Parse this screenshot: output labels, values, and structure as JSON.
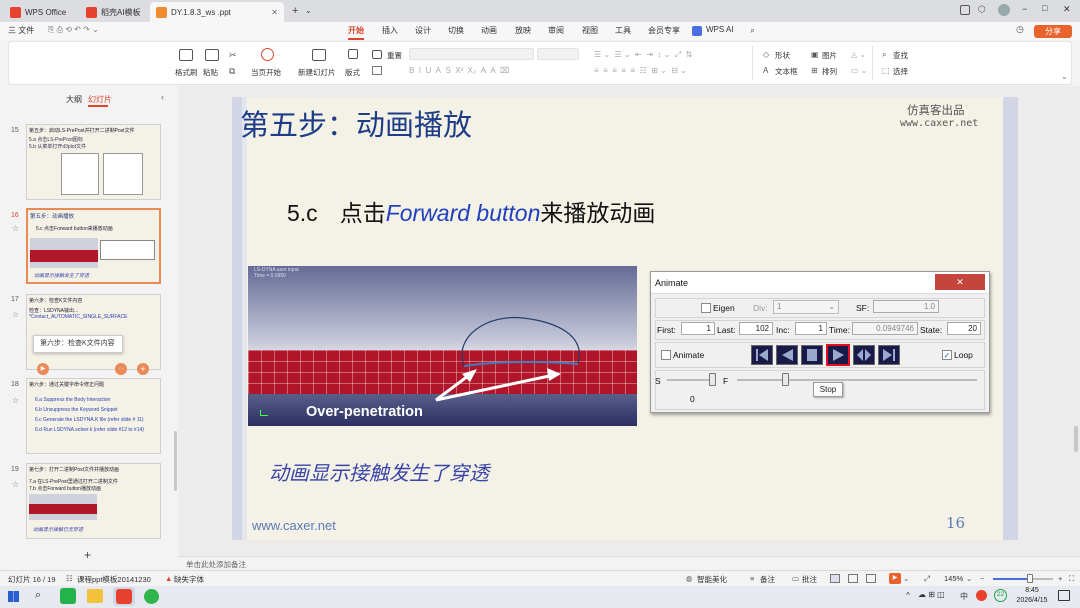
{
  "titlebar": {
    "tabs": [
      {
        "label": "WPS Office"
      },
      {
        "label": "稻壳AI模板"
      },
      {
        "label": "DY.1.8.3_ws .ppt"
      }
    ],
    "add_tab": "+",
    "window_controls": {
      "minimize": "−",
      "maximize": "□",
      "close": "✕"
    }
  },
  "menubar": {
    "file": "三 文件",
    "items": [
      "开始",
      "插入",
      "设计",
      "切换",
      "动画",
      "放映",
      "审阅",
      "视图",
      "工具",
      "会员专享"
    ],
    "active": "开始",
    "wps_ai": "WPS AI",
    "share": "分享"
  },
  "ribbon": {
    "format_painter": "格式刷",
    "paste": "粘贴",
    "from_current": "当页开始",
    "new_slide": "新建幻灯片",
    "layout": "版式",
    "reset": "重置",
    "shape": "形状",
    "textbox": "文本框",
    "picture": "图片",
    "arrange": "排列",
    "find": "查找",
    "select": "选择"
  },
  "panel": {
    "tab_outline": "大纲",
    "tab_slides": "幻灯片",
    "thumbs": [
      {
        "num": "15",
        "title": "第五步：启动LS-PrePost并打开二进制Post文件",
        "sub": "5.a 点击LS-PrePost图标",
        "sub2": "5.b 从菜单打开d3plot文件"
      },
      {
        "num": "16",
        "title": "第五步：动画播放",
        "sub": "5.c 点击Forward button来播放动画",
        "caption": "动画显示接触发生了穿透"
      },
      {
        "num": "17",
        "title": "第六步：检查K文件内容",
        "sub": "检查：LSDYNA输出...",
        "sub2": "*Contact_AUTOMATIC_SINGLE_SURFACE",
        "tooltip": "第六步：检查K文件内容"
      },
      {
        "num": "18",
        "title": "第六步：通过关键字命令修正问题",
        "l1": "6.a Suppress the Body Interaction",
        "l2": "6.b Unsuppress the Keyword Snippet",
        "l3": "6.c Generate the LSDYNA.K file (refer slide # 11)",
        "l4": "6.d Run LSDYNA.solver.k (refer slide #12 to #14)"
      },
      {
        "num": "19",
        "title": "第七步：打开二进制Post文件并播放动画",
        "sub": "7.a 在LS-PrePost里通过打开二进制文件",
        "sub2": "7.b 点击Forward button播放动画",
        "caption": "动画显示接触已无穿透"
      }
    ],
    "add_slide": "+"
  },
  "slide": {
    "title": "第五步：动画播放",
    "brand_cn": "仿真客出品",
    "brand_url": "www.caxer.net",
    "step_num": "5.c",
    "step_pre": "点击",
    "step_btn": "Forward button",
    "step_post": "来播放动画",
    "sim_header": "LS-DYNA user input",
    "sim_time": "Time =   0.0950",
    "sim_label": "Over-penetration",
    "caption": "动画显示接触发生了穿透",
    "footer_url": "www.caxer.net",
    "page_num": "16"
  },
  "animate": {
    "title": "Animate",
    "close": "✕",
    "eigen": "Eigen",
    "div_label": "Div:",
    "div_value": "1",
    "sf_label": "SF:",
    "sf_value": "1.0",
    "first_label": "First:",
    "first_value": "1",
    "last_label": "Last:",
    "last_value": "102",
    "inc_label": "Inc:",
    "inc_value": "1",
    "time_label": "Time:",
    "time_value": "0.0949746",
    "state_label": "State:",
    "state_value": "20",
    "animate_label": "Animate",
    "loop_label": "Loop",
    "loop_checked": "✓",
    "s_label": "S",
    "f_label": "F",
    "s_value": "0",
    "tooltip": "Stop"
  },
  "notes": {
    "placeholder": "单击此处添加备注"
  },
  "status": {
    "slide": "幻灯片 16 / 19",
    "template": "课程ppt模板20141230",
    "font": "缺失字体",
    "smart": "智能美化",
    "notes": "备注",
    "comment": "批注",
    "zoom": "145%"
  },
  "taskbar": {
    "time": "8:45",
    "date": "2026/4/15",
    "lang": "中",
    "badge": "22"
  }
}
